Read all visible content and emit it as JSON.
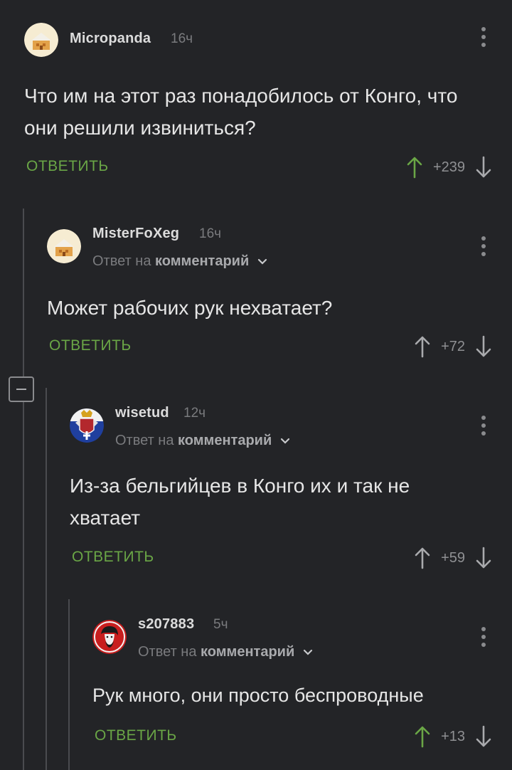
{
  "comments": [
    {
      "username": "Micropanda",
      "time": "16ч",
      "text": "Что им на этот раз понадобилось от Конго, что они решили извиниться?",
      "reply_label": "ОТВЕТИТЬ",
      "score": "+239",
      "upvoted": true,
      "avatar": "pixel-house-avatar"
    },
    {
      "username": "MisterFoXeg",
      "time": "16ч",
      "reply_prefix": "Ответ на",
      "reply_target": "комментарий",
      "text": "Может рабочих рук нехватает?",
      "reply_label": "ОТВЕТИТЬ",
      "score": "+72",
      "upvoted": false,
      "avatar": "pixel-house-avatar"
    },
    {
      "username": "wisetud",
      "time": "12ч",
      "reply_prefix": "Ответ на",
      "reply_target": "комментарий",
      "text": "Из-за бельгийцев в Конго их и так не хватает",
      "reply_label": "ОТВЕТИТЬ",
      "score": "+59",
      "upvoted": false,
      "avatar": "coat-of-arms-avatar"
    },
    {
      "username": "s207883",
      "time": "5ч",
      "reply_prefix": "Ответ на",
      "reply_target": "комментарий",
      "text": "Рук много, они просто беспроводные",
      "reply_label": "ОТВЕТИТЬ",
      "score": "+13",
      "upvoted": true,
      "avatar": "che-portrait-avatar"
    }
  ],
  "colors": {
    "background": "#232427",
    "reply_green": "#6aa646",
    "upvote_green": "#6aa646",
    "muted": "#7a7b7e",
    "thread_line": "#4a4b4f"
  }
}
